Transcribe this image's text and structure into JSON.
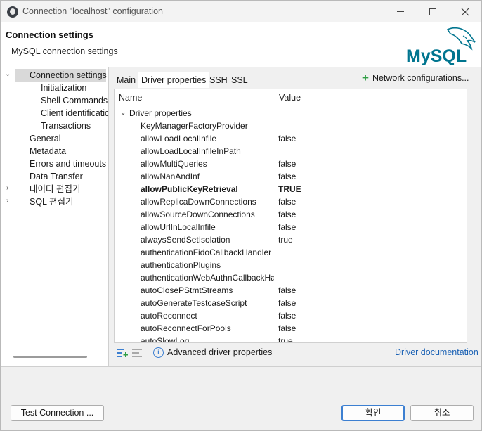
{
  "window": {
    "title": "Connection \"localhost\" configuration"
  },
  "header": {
    "title": "Connection settings",
    "subtitle": "MySQL connection settings",
    "logo_text": "MySQL"
  },
  "tree": {
    "items": [
      {
        "label": "Connection settings",
        "selected": true,
        "expanded": true
      },
      {
        "label": "Initialization"
      },
      {
        "label": "Shell Commands"
      },
      {
        "label": "Client identification"
      },
      {
        "label": "Transactions"
      },
      {
        "label": "General"
      },
      {
        "label": "Metadata"
      },
      {
        "label": "Errors and timeouts"
      },
      {
        "label": "Data Transfer"
      },
      {
        "label": "데이터 편집기",
        "collapsed": true
      },
      {
        "label": "SQL 편집기",
        "collapsed": true
      }
    ]
  },
  "tabs": [
    {
      "label": "Main"
    },
    {
      "label": "Driver properties",
      "active": true
    },
    {
      "label": "SSH"
    },
    {
      "label": "SSL"
    }
  ],
  "network_configurations_label": "Network configurations...",
  "table": {
    "columns": [
      "Name",
      "Value"
    ],
    "group": "Driver properties",
    "rows": [
      {
        "name": "KeyManagerFactoryProvider",
        "value": ""
      },
      {
        "name": "allowLoadLocalInfile",
        "value": "false"
      },
      {
        "name": "allowLoadLocalInfileInPath",
        "value": ""
      },
      {
        "name": "allowMultiQueries",
        "value": "false"
      },
      {
        "name": "allowNanAndInf",
        "value": "false"
      },
      {
        "name": "allowPublicKeyRetrieval",
        "value": "TRUE",
        "bold": true
      },
      {
        "name": "allowReplicaDownConnections",
        "value": "false"
      },
      {
        "name": "allowSourceDownConnections",
        "value": "false"
      },
      {
        "name": "allowUrlInLocalInfile",
        "value": "false"
      },
      {
        "name": "alwaysSendSetIsolation",
        "value": "true"
      },
      {
        "name": "authenticationFidoCallbackHandler",
        "value": ""
      },
      {
        "name": "authenticationPlugins",
        "value": ""
      },
      {
        "name": "authenticationWebAuthnCallbackHandler",
        "value": ""
      },
      {
        "name": "autoClosePStmtStreams",
        "value": "false"
      },
      {
        "name": "autoGenerateTestcaseScript",
        "value": "false"
      },
      {
        "name": "autoReconnect",
        "value": "false"
      },
      {
        "name": "autoReconnectForPools",
        "value": "false"
      },
      {
        "name": "autoSlowLog",
        "value": "true"
      }
    ]
  },
  "bottom": {
    "advanced_label": "Advanced driver properties",
    "driver_doc_label": "Driver documentation"
  },
  "footer": {
    "test_label": "Test Connection ...",
    "ok_label": "확인",
    "cancel_label": "취소"
  },
  "colors": {
    "accent": "#3c7fd1",
    "link": "#1d63b5",
    "add_green": "#2f9e44",
    "mysql_blue": "#00758f",
    "mysql_orange": "#f29111"
  }
}
